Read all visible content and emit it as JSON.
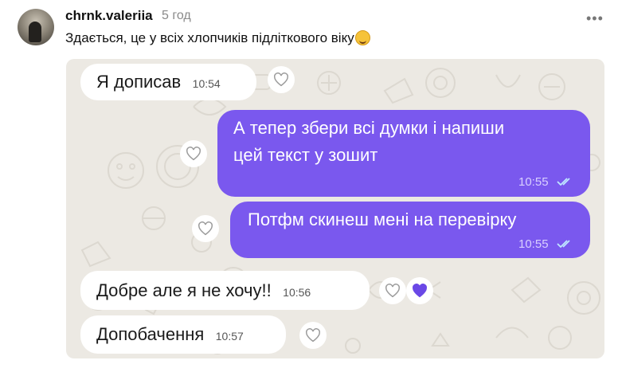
{
  "post": {
    "username": "chrnk.valeriia",
    "time_ago": "5 год",
    "caption": "Здається, це у всіх хлопчиків підліткового віку",
    "caption_emoji": "rolling-on-floor-laughing-emoji",
    "more_icon": "more-dots-icon"
  },
  "chat": {
    "messages": [
      {
        "direction": "in",
        "text": "Я дописав",
        "time": "10:54"
      },
      {
        "direction": "out",
        "text_line1": "А тепер збери всі думки і напиши",
        "text_line2": "цей текст у зошит",
        "time": "10:55",
        "read": true
      },
      {
        "direction": "out",
        "text": "Потфм скинеш мені на перевірку",
        "time": "10:55",
        "read": true
      },
      {
        "direction": "in",
        "text": "Добре але я не хочу!!",
        "time": "10:56",
        "liked": true
      },
      {
        "direction": "in",
        "text": "Допобачення",
        "time": "10:57"
      }
    ]
  },
  "colors": {
    "outgoing_bubble": "#7a58ee",
    "incoming_bubble": "#ffffff",
    "chat_background": "#ece9e3",
    "liked_heart": "#6a48e6"
  }
}
